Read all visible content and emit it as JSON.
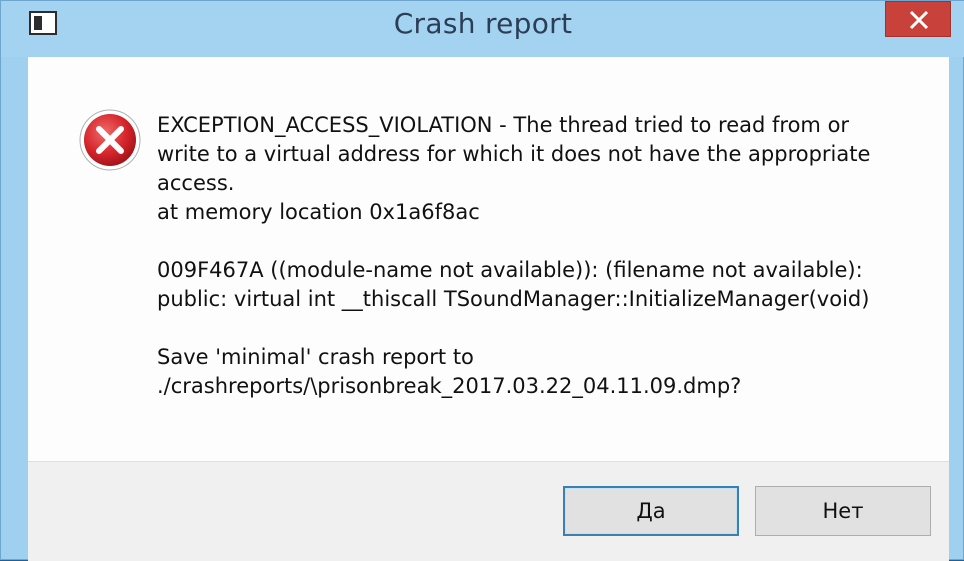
{
  "window": {
    "title": "Crash report"
  },
  "icons": {
    "app": "app-window-icon",
    "close": "close-icon",
    "error": "error-icon"
  },
  "message": {
    "lines": [
      "EXCEPTION_ACCESS_VIOLATION - The thread tried to read from or",
      "write to a virtual address for which it does not have the appropriate",
      "access.",
      "at memory location 0x1a6f8ac",
      "009F467A ((module-name not available)): (filename not available):",
      "public: virtual int __thiscall TSoundManager::InitializeManager(void)",
      "Save 'minimal' crash report to",
      "./crashreports/\\prisonbreak_2017.03.22_04.11.09.dmp?"
    ]
  },
  "buttons": {
    "yes": "Да",
    "no": "Нет"
  },
  "colors": {
    "titlebar": "#a4d3f1",
    "close_button": "#c9413b",
    "error_red": "#d4252b",
    "default_button_border": "#3c7fb1"
  }
}
